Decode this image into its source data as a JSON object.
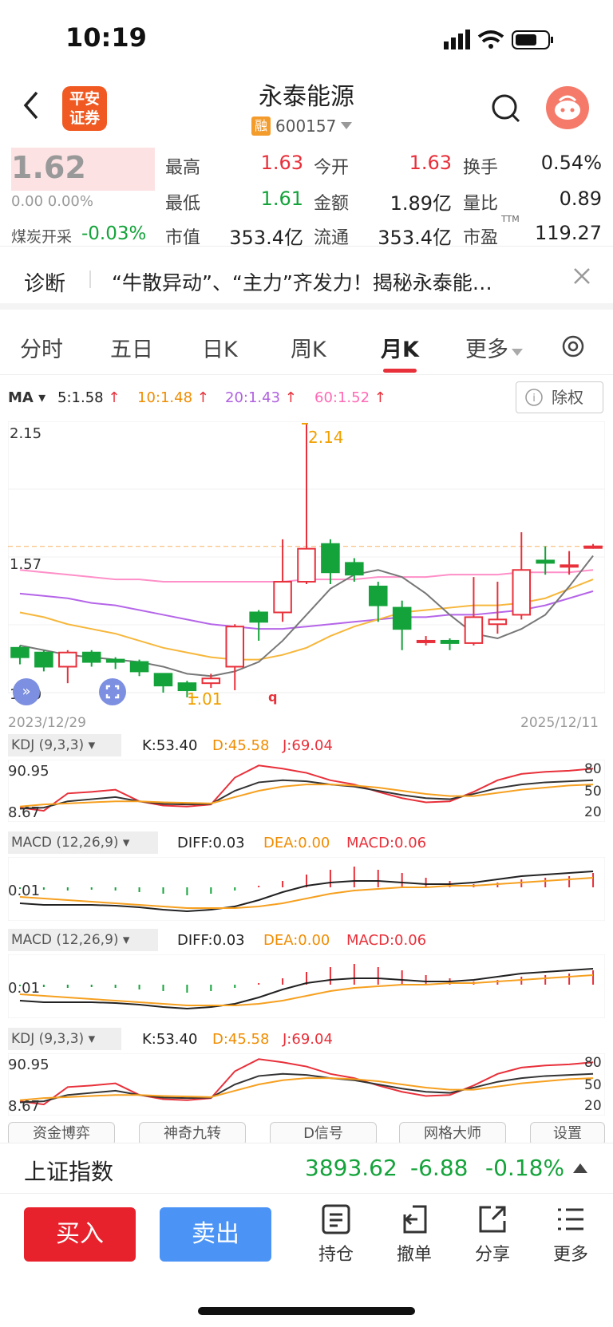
{
  "status": {
    "time": "10:19"
  },
  "header": {
    "title": "永泰能源",
    "code": "600157",
    "rong": "融",
    "logo_line1": "平安",
    "logo_line2": "证券"
  },
  "quote": {
    "price": "1.62",
    "change": "0.00 0.00%",
    "sector": "煤炭开采",
    "sector_change": "-0.03%",
    "rows": [
      [
        {
          "l": "最高",
          "v": "1.63",
          "c": "red"
        },
        {
          "l": "今开",
          "v": "1.63",
          "c": "red"
        },
        {
          "l": "换手",
          "v": "0.54%",
          "c": "dark"
        }
      ],
      [
        {
          "l": "最低",
          "v": "1.61",
          "c": "green"
        },
        {
          "l": "金额",
          "v": "1.89亿",
          "c": "dark"
        },
        {
          "l": "量比",
          "v": "0.89",
          "c": "dark"
        }
      ],
      [
        {
          "l": "市值",
          "v": "353.4亿",
          "c": "dark"
        },
        {
          "l": "流通",
          "v": "353.4亿",
          "c": "dark"
        },
        {
          "l": "市盈",
          "v": "119.27",
          "c": "dark"
        }
      ]
    ],
    "ttm": "TTM"
  },
  "diagnosis": {
    "label": "诊断",
    "text": "“牛散异动”、“主力”齐发力！揭秘永泰能…"
  },
  "tabs": [
    "分时",
    "五日",
    "日K",
    "周K",
    "月K",
    "更多"
  ],
  "ma": {
    "label": "MA",
    "v5": "5:1.58",
    "v10": "10:1.48",
    "v20": "20:1.43",
    "v60": "60:1.52",
    "chuquan": "除权"
  },
  "kchart": {
    "top": "2.15",
    "mid": "1.57",
    "bottom": "1.00",
    "high": "2.14",
    "low": "1.01",
    "date_start": "2023/12/29",
    "date_end": "2025/12/11"
  },
  "kdj": {
    "title": "KDJ (9,3,3)",
    "k": "K:53.40",
    "d": "D:45.58",
    "j": "J:69.04",
    "top": "90.95",
    "bottom": "8.67",
    "l80": "80",
    "l50": "50",
    "l20": "20"
  },
  "macd": {
    "title": "MACD (12,26,9)",
    "diff": "DIFF:0.03",
    "dea": "DEA:0.00",
    "macd": "MACD:0.06",
    "axis": "0.01"
  },
  "chips": [
    "资金博弈",
    "神奇九转",
    "D信号",
    "网格大师",
    "设置"
  ],
  "index": {
    "name": "上证指数",
    "value": "3893.62",
    "change": "-6.88",
    "pct": "-0.18%"
  },
  "toolbar": {
    "buy": "买入",
    "sell": "卖出",
    "hold": "持仓",
    "cancel": "撤单",
    "share": "分享",
    "more": "更多"
  },
  "colors": {
    "up": "#e8303a",
    "down": "#14a33a",
    "buy": "#e8222c",
    "sell": "#4b94f5"
  },
  "chart_data": {
    "type": "candlestick",
    "candles": [
      {
        "o": 1.19,
        "c": 1.15,
        "h": 1.2,
        "l": 1.12
      },
      {
        "o": 1.17,
        "c": 1.11,
        "h": 1.18,
        "l": 1.09
      },
      {
        "o": 1.11,
        "c": 1.17,
        "h": 1.18,
        "l": 1.04
      },
      {
        "o": 1.17,
        "c": 1.13,
        "h": 1.18,
        "l": 1.11
      },
      {
        "o": 1.14,
        "c": 1.13,
        "h": 1.15,
        "l": 1.1
      },
      {
        "o": 1.13,
        "c": 1.09,
        "h": 1.14,
        "l": 1.07
      },
      {
        "o": 1.08,
        "c": 1.03,
        "h": 1.08,
        "l": 1.0
      },
      {
        "o": 1.04,
        "c": 1.01,
        "h": 1.05,
        "l": 0.98
      },
      {
        "o": 1.04,
        "c": 1.06,
        "h": 1.08,
        "l": 1.02
      },
      {
        "o": 1.11,
        "c": 1.28,
        "h": 1.29,
        "l": 1.01
      },
      {
        "o": 1.34,
        "c": 1.3,
        "h": 1.35,
        "l": 1.22
      },
      {
        "o": 1.34,
        "c": 1.47,
        "h": 1.65,
        "l": 1.3
      },
      {
        "o": 1.47,
        "c": 1.61,
        "h": 2.14,
        "l": 1.46
      },
      {
        "o": 1.63,
        "c": 1.51,
        "h": 1.65,
        "l": 1.46
      },
      {
        "o": 1.55,
        "c": 1.5,
        "h": 1.57,
        "l": 1.47
      },
      {
        "o": 1.45,
        "c": 1.37,
        "h": 1.47,
        "l": 1.3
      },
      {
        "o": 1.36,
        "c": 1.27,
        "h": 1.39,
        "l": 1.18
      },
      {
        "o": 1.22,
        "c": 1.22,
        "h": 1.24,
        "l": 1.2
      },
      {
        "o": 1.22,
        "c": 1.21,
        "h": 1.23,
        "l": 1.18
      },
      {
        "o": 1.21,
        "c": 1.32,
        "h": 1.49,
        "l": 1.2
      },
      {
        "o": 1.29,
        "c": 1.31,
        "h": 1.47,
        "l": 1.25
      },
      {
        "o": 1.33,
        "c": 1.52,
        "h": 1.68,
        "l": 1.31
      },
      {
        "o": 1.56,
        "c": 1.55,
        "h": 1.62,
        "l": 1.5
      },
      {
        "o": 1.54,
        "c": 1.54,
        "h": 1.6,
        "l": 1.5
      },
      {
        "o": 1.62,
        "c": 1.62,
        "h": 1.63,
        "l": 1.61
      }
    ],
    "ma5": [
      1.2,
      1.18,
      1.16,
      1.15,
      1.14,
      1.13,
      1.11,
      1.08,
      1.07,
      1.09,
      1.13,
      1.22,
      1.33,
      1.44,
      1.5,
      1.52,
      1.49,
      1.42,
      1.33,
      1.25,
      1.23,
      1.27,
      1.33,
      1.45,
      1.58
    ],
    "ma10": [
      1.34,
      1.32,
      1.29,
      1.27,
      1.25,
      1.22,
      1.19,
      1.17,
      1.15,
      1.14,
      1.14,
      1.16,
      1.19,
      1.24,
      1.28,
      1.31,
      1.34,
      1.35,
      1.36,
      1.37,
      1.37,
      1.38,
      1.4,
      1.44,
      1.48
    ],
    "ma20": [
      1.42,
      1.41,
      1.4,
      1.38,
      1.37,
      1.35,
      1.33,
      1.31,
      1.29,
      1.28,
      1.27,
      1.27,
      1.28,
      1.29,
      1.3,
      1.31,
      1.32,
      1.32,
      1.33,
      1.33,
      1.34,
      1.35,
      1.37,
      1.4,
      1.43
    ],
    "ma60": [
      1.52,
      1.51,
      1.5,
      1.49,
      1.48,
      1.48,
      1.47,
      1.47,
      1.47,
      1.47,
      1.47,
      1.47,
      1.48,
      1.48,
      1.48,
      1.49,
      1.49,
      1.49,
      1.5,
      1.5,
      1.5,
      1.51,
      1.51,
      1.51,
      1.52
    ],
    "ylim": [
      1.0,
      2.15
    ]
  }
}
